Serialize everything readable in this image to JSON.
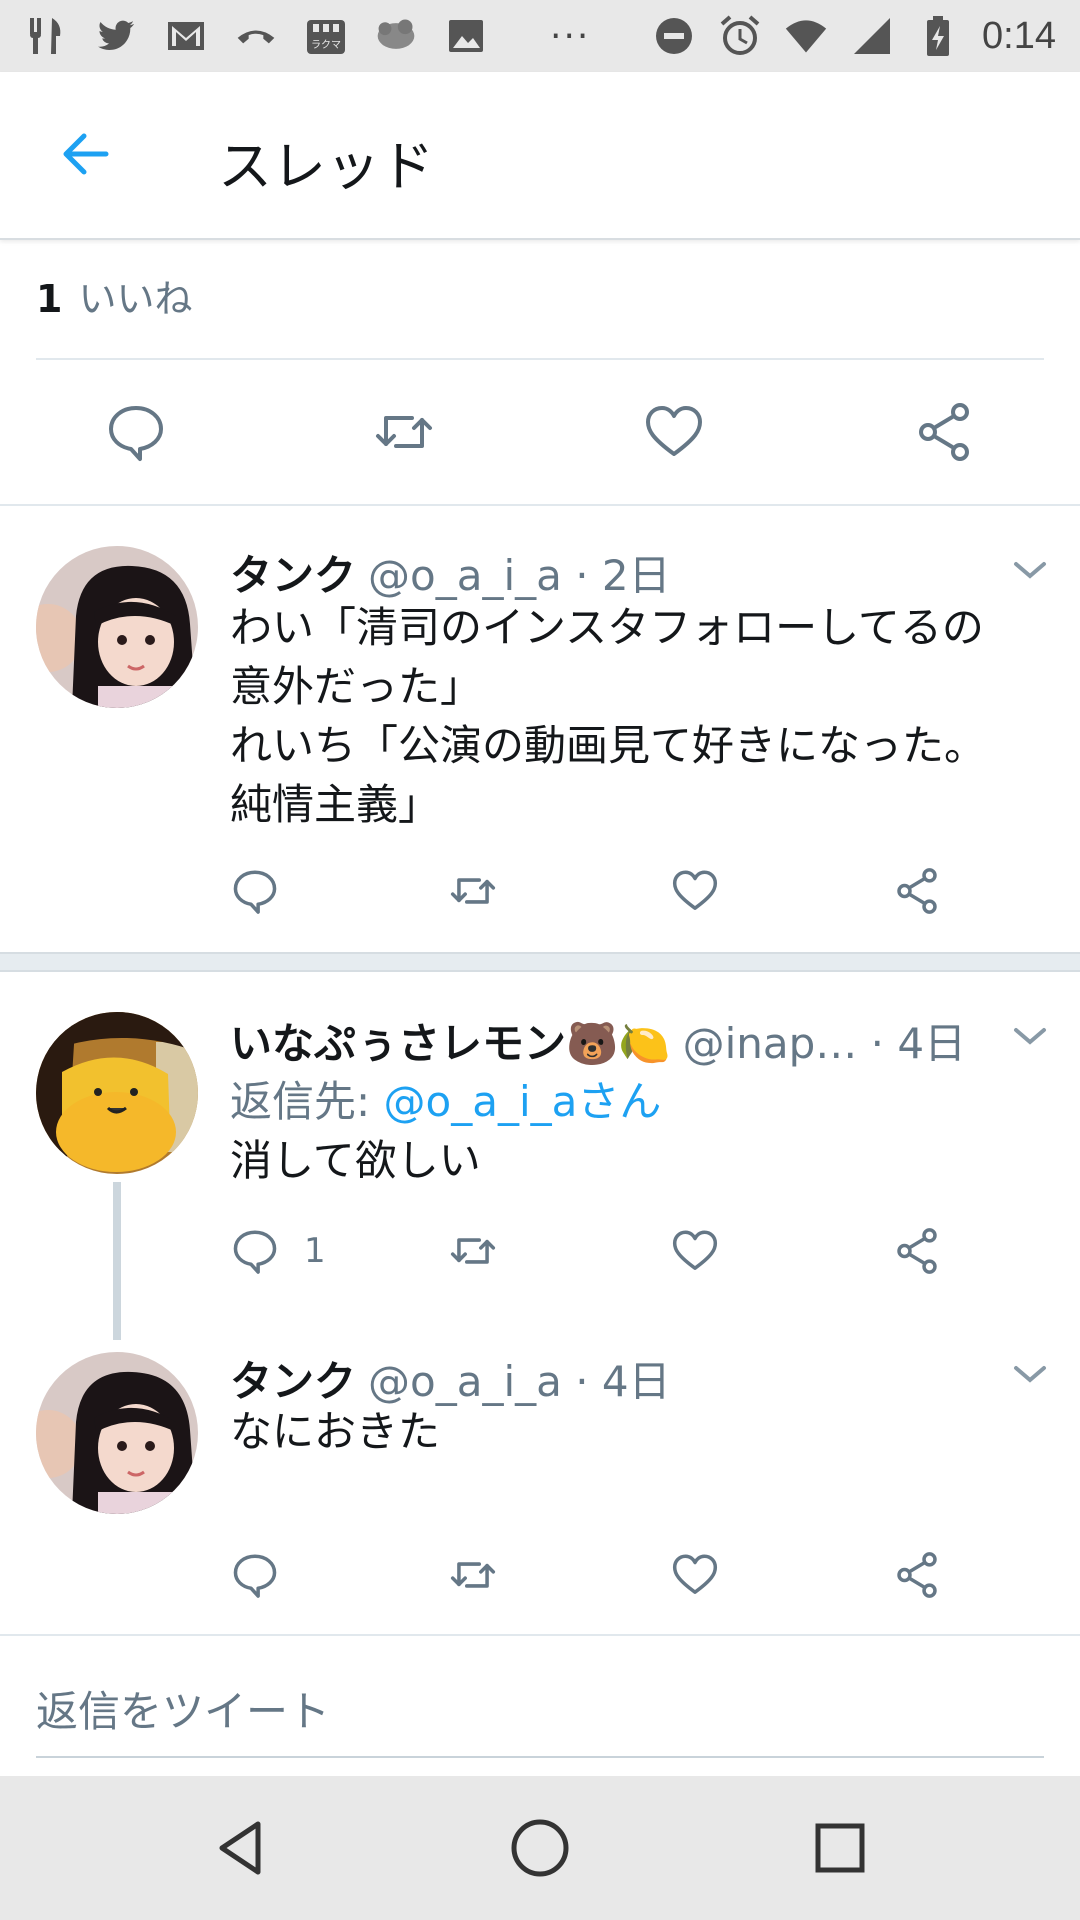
{
  "status_bar": {
    "left_icons": [
      "cutlery-icon",
      "twitter-icon",
      "gmail-icon",
      "phone-icon",
      "rakuma-icon",
      "sheep-icon",
      "image-icon"
    ],
    "more": "···",
    "right_icons": [
      "do-not-disturb-icon",
      "alarm-icon",
      "wifi-icon",
      "signal-icon",
      "battery-charging-icon"
    ],
    "time": "0:14"
  },
  "app_bar": {
    "title": "スレッド"
  },
  "likes": {
    "count": "1",
    "label": "いいね"
  },
  "tweets": [
    {
      "name": "タンク",
      "handle": "@o_a_i_a",
      "time": "· 2日",
      "lines": [
        "わい「清司のインスタフォローしてるの",
        "意外だった」",
        "れいち「公演の動画見て好きになった。",
        "純情主義」"
      ],
      "reply_count": ""
    },
    {
      "name": "いなぷぅさレモン🐻🍋",
      "handle": "@inap…",
      "time": "· 4日",
      "reply_prefix": "返信先: ",
      "reply_mention": "@o_a_i_aさん",
      "lines": [
        "消して欲しい"
      ],
      "reply_count": "1"
    },
    {
      "name": "タンク",
      "handle": "@o_a_i_a",
      "time": "· 4日",
      "lines": [
        "なにおきた"
      ],
      "reply_count": ""
    }
  ],
  "reply_placeholder": "返信をツイート",
  "colors": {
    "accent": "#1da1f2",
    "secondary_text": "#657786",
    "icon": "#657786",
    "divider": "#e1e8ed"
  }
}
